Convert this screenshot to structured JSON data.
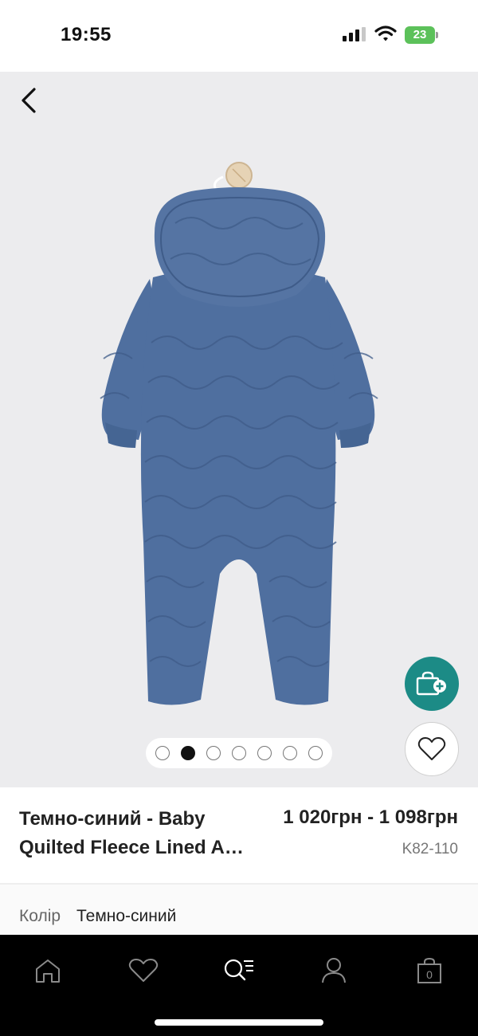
{
  "status_bar": {
    "time": "19:55",
    "battery": "23"
  },
  "product": {
    "title_line1": "Темно-синий - Baby",
    "title_line2": "Quilted Fleece Lined A…",
    "price": "1 020грн - 1 098грн",
    "sku": "K82-110",
    "colour_label": "Колір",
    "colour_value": "Темно-синий",
    "garment_color": "#4f6f9f",
    "image_pager": {
      "total": 7,
      "active_index": 1
    }
  },
  "colors": {
    "accent": "#1c8b86",
    "image_background": "#ececee",
    "nav_background": "#000000"
  },
  "icons": {
    "back": "chevron-left-icon",
    "add_to_bag": "bag-plus-icon",
    "wishlist": "heart-icon",
    "nav_home": "home-icon",
    "nav_favourites": "heart-icon",
    "nav_search": "search-icon",
    "nav_account": "user-icon",
    "nav_bag": "bag-icon"
  },
  "bottom_nav": {
    "bag_count": "0"
  }
}
